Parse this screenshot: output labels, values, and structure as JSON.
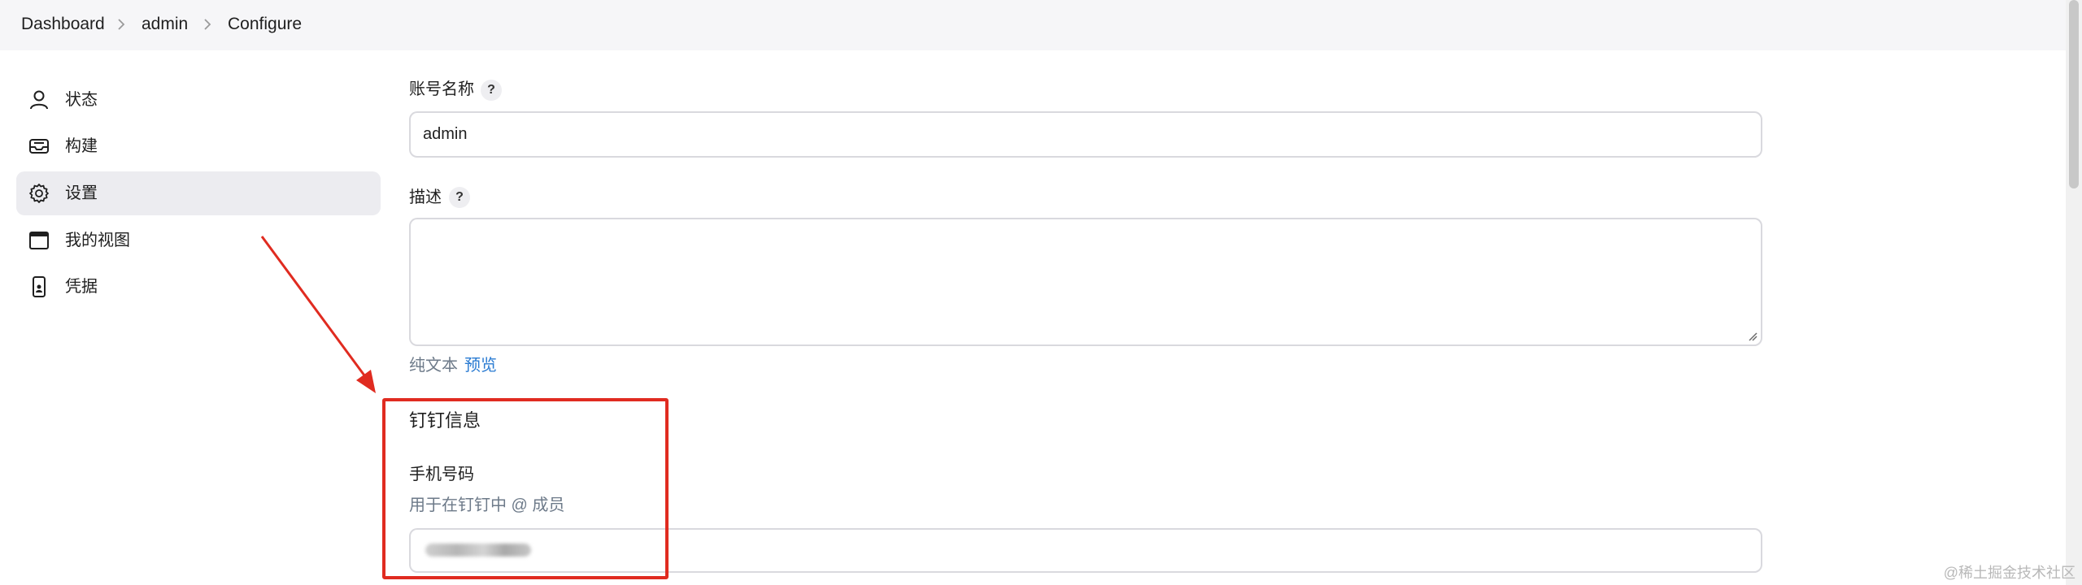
{
  "breadcrumb": {
    "items": [
      "Dashboard",
      "admin",
      "Configure"
    ]
  },
  "sidebar": {
    "items": [
      {
        "label": "状态",
        "icon": "user-icon"
      },
      {
        "label": "构建",
        "icon": "inbox-icon"
      },
      {
        "label": "设置",
        "icon": "gear-icon",
        "active": true
      },
      {
        "label": "我的视图",
        "icon": "window-icon"
      },
      {
        "label": "凭据",
        "icon": "phone-badge-icon"
      }
    ]
  },
  "form": {
    "account_name_label": "账号名称",
    "account_name_value": "admin",
    "help_glyph": "?",
    "description_label": "描述",
    "description_value": "",
    "plain_text_link": "纯文本",
    "preview_link": "预览",
    "dingtalk_section_title": "钉钉信息",
    "phone_label": "手机号码",
    "phone_hint": "用于在钉钉中 @ 成员"
  },
  "annotation": {
    "color": "#e02b20"
  },
  "watermark": "@稀土掘金技术社区"
}
